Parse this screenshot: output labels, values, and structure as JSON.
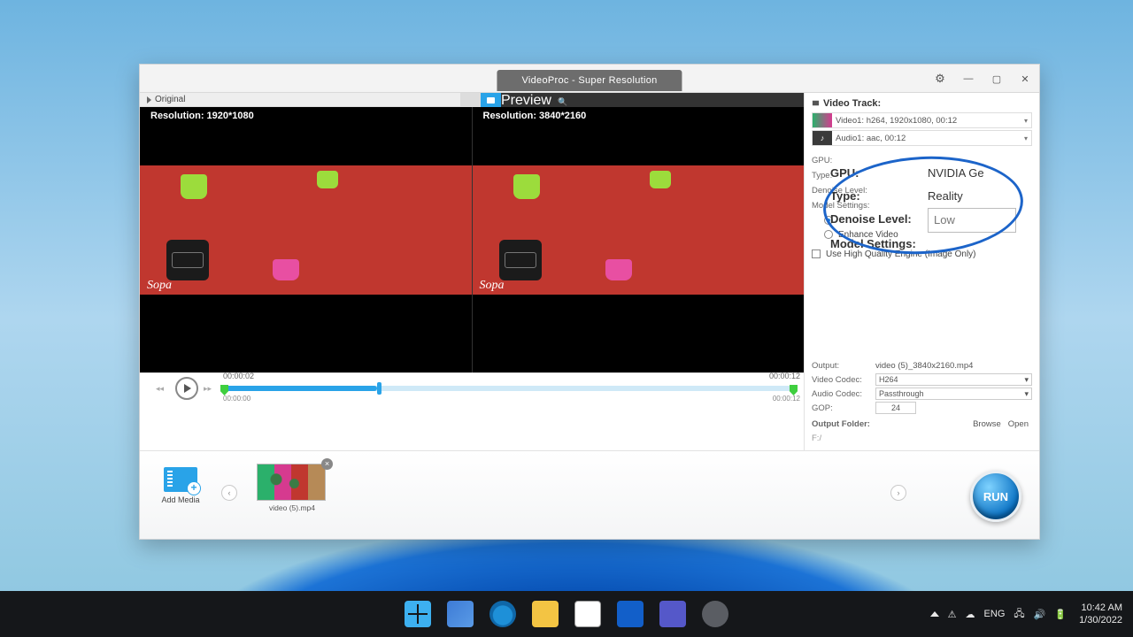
{
  "window": {
    "title": "VideoProc - Super Resolution"
  },
  "preview": {
    "original_label": "Original",
    "preview_label": "Preview",
    "left_resolution": "Resolution: 1920*1080",
    "right_resolution": "Resolution: 3840*2160",
    "watermark": "Sopa"
  },
  "transport": {
    "pos_time": "00:00:02",
    "dur_time": "00:00:12",
    "start_time": "00:00:00",
    "end_time": "00:00:12"
  },
  "right_panel": {
    "heading": "Video Track:",
    "video_track": "Video1: h264, 1920x1080, 00:12",
    "audio_track": "Audio1: aac, 00:12",
    "gpu_label": "GPU:",
    "type_label": "Type:",
    "denoise_label": "Denoise Level:",
    "model_label": "Model Settings:",
    "radio_enhance": "Enhance Video",
    "chk_hq": "Use High Quality Engine (Image Only)",
    "output_label": "Output:",
    "output_value": "video (5)_3840x2160.mp4",
    "video_codec_label": "Video Codec:",
    "video_codec_value": "H264",
    "audio_codec_label": "Audio Codec:",
    "audio_codec_value": "Passthrough",
    "gop_label": "GOP:",
    "gop_value": "24",
    "folder_label": "Output Folder:",
    "folder_value": "F:/",
    "browse": "Browse",
    "open": "Open"
  },
  "callout": {
    "gpu_label": "GPU:",
    "gpu_value": "NVIDIA Ge",
    "type_label": "Type:",
    "type_value": "Reality",
    "denoise_label": "Denoise Level:",
    "denoise_value": "Low",
    "model_label": "Model Settings:"
  },
  "media_strip": {
    "add_label": "Add Media",
    "clip_name": "video (5).mp4",
    "run_label": "RUN"
  },
  "taskbar": {
    "lang": "ENG",
    "time": "10:42 AM",
    "date": "1/30/2022"
  }
}
